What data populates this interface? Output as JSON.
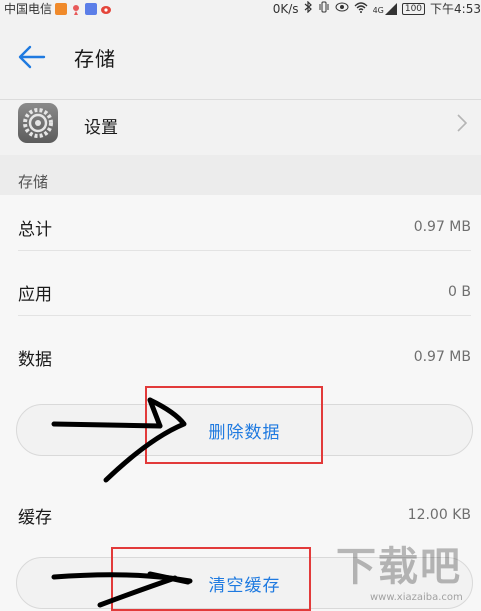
{
  "status_bar": {
    "carrier": "中国电信",
    "speed": "0K/s",
    "network": "4G",
    "battery": "100",
    "time": "下午4:53"
  },
  "header": {
    "title": "存储"
  },
  "settings_app": {
    "label": "设置"
  },
  "storage_section": {
    "title": "存储",
    "rows": [
      {
        "label": "总计",
        "value": "0.97 MB"
      },
      {
        "label": "应用",
        "value": "0 B"
      },
      {
        "label": "数据",
        "value": "0.97 MB"
      },
      {
        "label": "缓存",
        "value": "12.00 KB"
      }
    ],
    "clear_data_label": "删除数据",
    "clear_cache_label": "清空缓存"
  },
  "watermark": {
    "text": "下载吧",
    "url": "www.xiazaiba.com"
  },
  "colors": {
    "accent": "#1f7ae0",
    "highlight": "#e23a3a",
    "background": "#f2f2f2"
  }
}
